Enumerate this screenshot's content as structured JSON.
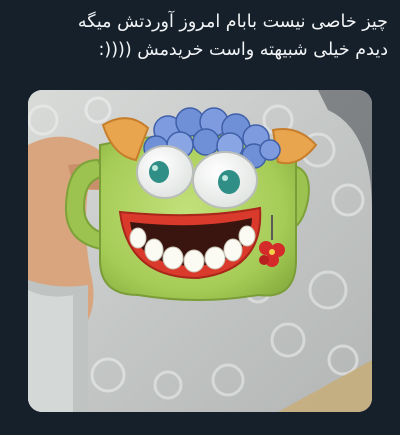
{
  "post": {
    "text_line_1": "چیز خاصی نیست بابام امروز آوردتش میگه",
    "text_line_2": "دیدم خیلی شبیهته واست خریدمش ((((:"
  },
  "media": {
    "subject": "ceramic-monster-mug-photo",
    "palette": {
      "background": "#15202b",
      "mug_green": "#a9cf5a",
      "hair_blue": "#6f8fd6",
      "horn_orange": "#e8a14a",
      "lips_red": "#d93a2b",
      "eye_iris": "#2f8f86"
    }
  }
}
